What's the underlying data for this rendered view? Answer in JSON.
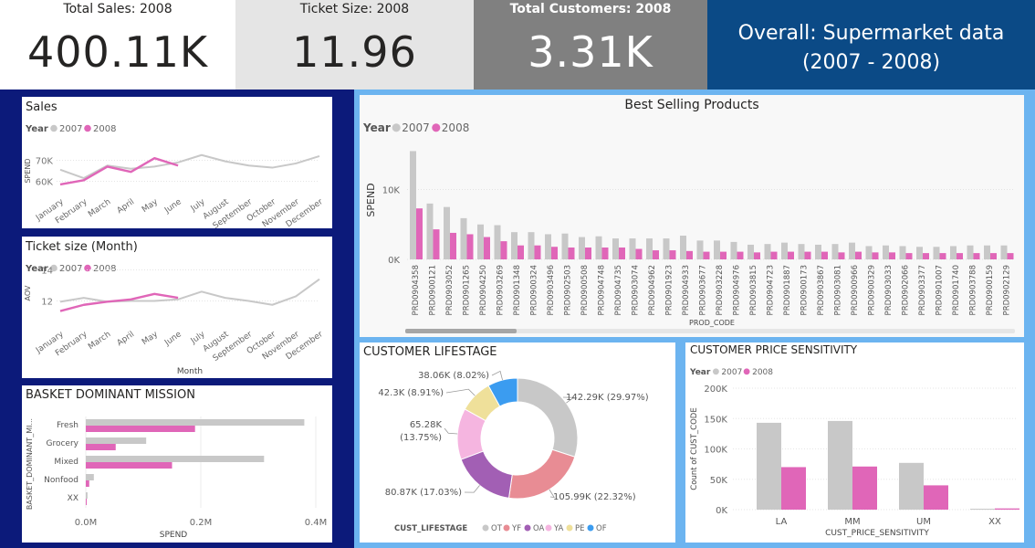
{
  "kpis": {
    "sales": {
      "label": "Total Sales: 2008",
      "value": "400.11K"
    },
    "ticket": {
      "label": "Ticket Size: 2008",
      "value": "11.96"
    },
    "customers": {
      "label": "Total Customers: 2008",
      "value": "3.31K"
    }
  },
  "banner": {
    "line1": "Overall: Supermarket data",
    "line2": "(2007 - 2008)"
  },
  "colors": {
    "s2007": "#c8c8c8",
    "s2008": "#e066b8",
    "navy": "#0c1a7a",
    "blue_bg": "#6cb4f0",
    "banner": "#0b4a86",
    "kpi_gray": "#808080",
    "kpi_light": "#e5e5e5"
  },
  "legend": {
    "title": "Year",
    "s2007": "2007",
    "s2008": "2008"
  },
  "chart_data": [
    {
      "id": "sales",
      "type": "line",
      "title": "Sales",
      "ylabel": "SPEND",
      "xlabel": "",
      "categories": [
        "January",
        "February",
        "March",
        "April",
        "May",
        "June",
        "July",
        "August",
        "September",
        "October",
        "November",
        "December"
      ],
      "ylim": [
        55000,
        75000
      ],
      "yticks": [
        {
          "v": 60000,
          "label": "60K"
        },
        {
          "v": 70000,
          "label": "70K"
        }
      ],
      "series": [
        {
          "name": "2007",
          "values": [
            65500,
            61500,
            67500,
            66000,
            67000,
            69000,
            72500,
            69500,
            67500,
            66500,
            68500,
            72000
          ]
        },
        {
          "name": "2008",
          "values": [
            58500,
            60500,
            67000,
            64500,
            71000,
            67500
          ]
        }
      ]
    },
    {
      "id": "ticket",
      "type": "line",
      "title": "Ticket size (Month)",
      "ylabel": "AOV",
      "xlabel": "Month",
      "categories": [
        "January",
        "February",
        "March",
        "April",
        "May",
        "June",
        "July",
        "August",
        "September",
        "October",
        "November",
        "December"
      ],
      "ylim": [
        10.5,
        14.5
      ],
      "yticks": [
        {
          "v": 12,
          "label": "12"
        },
        {
          "v": 14,
          "label": "14"
        }
      ],
      "series": [
        {
          "name": "2007",
          "values": [
            11.95,
            12.2,
            11.95,
            12.0,
            12.0,
            12.1,
            12.6,
            12.2,
            12.0,
            11.75,
            12.3,
            13.4
          ]
        },
        {
          "name": "2008",
          "values": [
            11.35,
            11.75,
            11.95,
            12.1,
            12.45,
            12.2
          ]
        }
      ]
    },
    {
      "id": "basket",
      "type": "bar",
      "orientation": "horizontal",
      "title": "BASKET DOMINANT MISSION",
      "ylabel": "BASKET_DOMINANT_MI...",
      "xlabel": "SPEND",
      "categories": [
        "Fresh",
        "Grocery",
        "Mixed",
        "Nonfood",
        "XX"
      ],
      "xlim": [
        0,
        400000
      ],
      "xticks": [
        {
          "v": 0,
          "label": "0.0M"
        },
        {
          "v": 200000,
          "label": "0.2M"
        },
        {
          "v": 400000,
          "label": "0.4M"
        }
      ],
      "series": [
        {
          "name": "2007",
          "values": [
            380000,
            105000,
            310000,
            14000,
            3000
          ]
        },
        {
          "name": "2008",
          "values": [
            190000,
            52000,
            150000,
            6000,
            1000
          ]
        }
      ]
    },
    {
      "id": "products",
      "type": "bar",
      "title": "Best Selling Products",
      "ylabel": "SPEND",
      "xlabel": "PROD_CODE",
      "categories": [
        "PRD0904358",
        "PRD0900121",
        "PRD0903052",
        "PRD0901265",
        "PRD0904250",
        "PRD0903269",
        "PRD0901348",
        "PRD0900324",
        "PRD0903496",
        "PRD0902503",
        "PRD0900508",
        "PRD0904748",
        "PRD0904735",
        "PRD0903074",
        "PRD0904962",
        "PRD0901923",
        "PRD0904933",
        "PRD0903677",
        "PRD0903228",
        "PRD0904976",
        "PRD0903815",
        "PRD0904723",
        "PRD0901887",
        "PRD0900173",
        "PRD0903867",
        "PRD0903081",
        "PRD0900966",
        "PRD0900329",
        "PRD0903033",
        "PRD0902066",
        "PRD0903377",
        "PRD0901007",
        "PRD0901740",
        "PRD0903788",
        "PRD0900159",
        "PRD0902129"
      ],
      "ylim": [
        0,
        17000
      ],
      "yticks": [
        {
          "v": 0,
          "label": "0K"
        },
        {
          "v": 10000,
          "label": "10K"
        }
      ],
      "series": [
        {
          "name": "2007",
          "values": [
            15500,
            8000,
            7500,
            5900,
            5000,
            4900,
            3900,
            3900,
            3600,
            3700,
            3200,
            3300,
            3000,
            3000,
            3000,
            3000,
            3400,
            2700,
            2700,
            2500,
            2100,
            2200,
            2400,
            2200,
            2100,
            2200,
            2400,
            1900,
            2000,
            1900,
            1800,
            1800,
            1900,
            2000,
            2000,
            2000
          ]
        },
        {
          "name": "2008",
          "values": [
            7300,
            4300,
            3800,
            3600,
            3200,
            2600,
            2000,
            2000,
            1800,
            1700,
            1700,
            1700,
            1700,
            1500,
            1300,
            1300,
            1200,
            1100,
            1100,
            1100,
            1000,
            1100,
            1100,
            1100,
            1100,
            1000,
            1100,
            1000,
            1000,
            900,
            900,
            900,
            900,
            900,
            900,
            900
          ]
        }
      ]
    },
    {
      "id": "lifestage",
      "type": "pie",
      "donut": true,
      "title": "CUSTOMER LIFESTAGE",
      "legend_title": "CUST_LIFESTAGE",
      "slices": [
        {
          "name": "OT",
          "value": 142290,
          "label": "142.29K (29.97%)",
          "color": "#c8c8c8"
        },
        {
          "name": "YF",
          "value": 105990,
          "label": "105.99K (22.32%)",
          "color": "#e88c94"
        },
        {
          "name": "OA",
          "value": 80870,
          "label": "80.87K (17.03%)",
          "color": "#a25fb4"
        },
        {
          "name": "YA",
          "value": 65280,
          "label": "65.28K (13.75%)",
          "color": "#f5b5e0"
        },
        {
          "name": "PE",
          "value": 42300,
          "label": "42.3K (8.91%)",
          "color": "#efe09a"
        },
        {
          "name": "OF",
          "value": 38060,
          "label": "38.06K (8.02%)",
          "color": "#3b9cf0"
        }
      ]
    },
    {
      "id": "sensitivity",
      "type": "bar",
      "title": "CUSTOMER PRICE SENSITIVITY",
      "ylabel": "Count of CUST_CODE",
      "xlabel": "CUST_PRICE_SENSITIVITY",
      "categories": [
        "LA",
        "MM",
        "UM",
        "XX"
      ],
      "ylim": [
        0,
        200000
      ],
      "yticks": [
        {
          "v": 0,
          "label": "0K"
        },
        {
          "v": 50000,
          "label": "50K"
        },
        {
          "v": 100000,
          "label": "100K"
        },
        {
          "v": 150000,
          "label": "150K"
        },
        {
          "v": 200000,
          "label": "200K"
        }
      ],
      "series": [
        {
          "name": "2007",
          "values": [
            143000,
            146000,
            77000,
            1500
          ]
        },
        {
          "name": "2008",
          "values": [
            70000,
            71000,
            40000,
            2000
          ]
        }
      ]
    }
  ]
}
